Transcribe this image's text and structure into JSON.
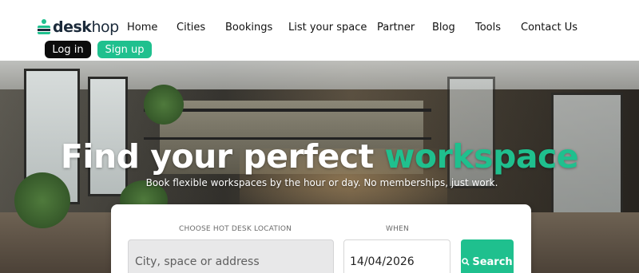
{
  "brand": {
    "name_part1": "desk",
    "name_part2": "hop"
  },
  "nav": [
    {
      "label": "Home"
    },
    {
      "label": "Cities"
    },
    {
      "label": "Bookings"
    },
    {
      "label": "List your space"
    },
    {
      "label": "Partner"
    },
    {
      "label": "Blog"
    },
    {
      "label": "Tools"
    },
    {
      "label": "Contact Us"
    }
  ],
  "auth": {
    "login_label": "Log in",
    "signup_label": "Sign up"
  },
  "hero": {
    "title_main": "Find your perfect",
    "title_accent": "workspace",
    "subtitle": "Book flexible workspaces by the hour or day.  No memberships, just work."
  },
  "search": {
    "location_label": "CHOOSE HOT DESK LOCATION",
    "location_placeholder": "City, space or address",
    "when_label": "WHEN",
    "date_value": "14/04/2026",
    "button_label": "Search",
    "button_icon": "search-icon"
  },
  "colors": {
    "accent": "#1fc08e",
    "dark": "#0c0c0c",
    "brand_text": "#1b2a3a"
  }
}
